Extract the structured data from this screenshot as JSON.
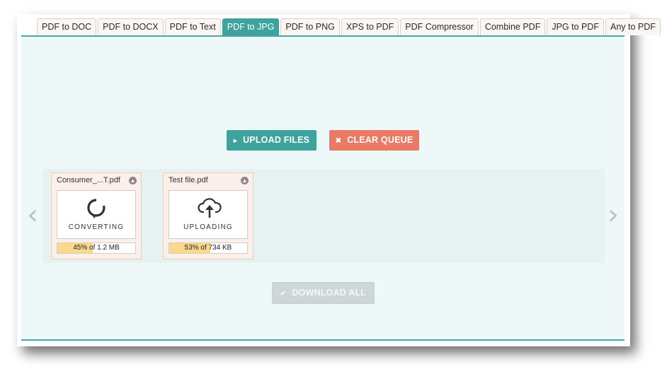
{
  "tabs": [
    {
      "label": "PDF to DOC",
      "active": false
    },
    {
      "label": "PDF to DOCX",
      "active": false
    },
    {
      "label": "PDF to Text",
      "active": false
    },
    {
      "label": "PDF to JPG",
      "active": true
    },
    {
      "label": "PDF to PNG",
      "active": false
    },
    {
      "label": "XPS to PDF",
      "active": false
    },
    {
      "label": "PDF Compressor",
      "active": false
    },
    {
      "label": "Combine PDF",
      "active": false
    },
    {
      "label": "JPG to PDF",
      "active": false
    },
    {
      "label": "Any to PDF",
      "active": false
    }
  ],
  "actions": {
    "upload_label": "UPLOAD FILES",
    "clear_label": "CLEAR QUEUE",
    "download_label": "DOWNLOAD ALL"
  },
  "queue": {
    "files": [
      {
        "name": "Consumer_...T.pdf",
        "status": "CONVERTING",
        "icon": "converting-icon",
        "progress_text": "45% of 1.2 MB",
        "progress_fraction": 0.45
      },
      {
        "name": "Test file.pdf",
        "status": "UPLOADING",
        "icon": "upload-cloud-icon",
        "progress_text": "53% of 734 KB",
        "progress_fraction": 0.53
      }
    ],
    "prev_arrow": "‹",
    "next_arrow": "›"
  },
  "colors": {
    "accent": "#3fa39d",
    "danger": "#ea7a63",
    "progress": "#fbd88a"
  }
}
